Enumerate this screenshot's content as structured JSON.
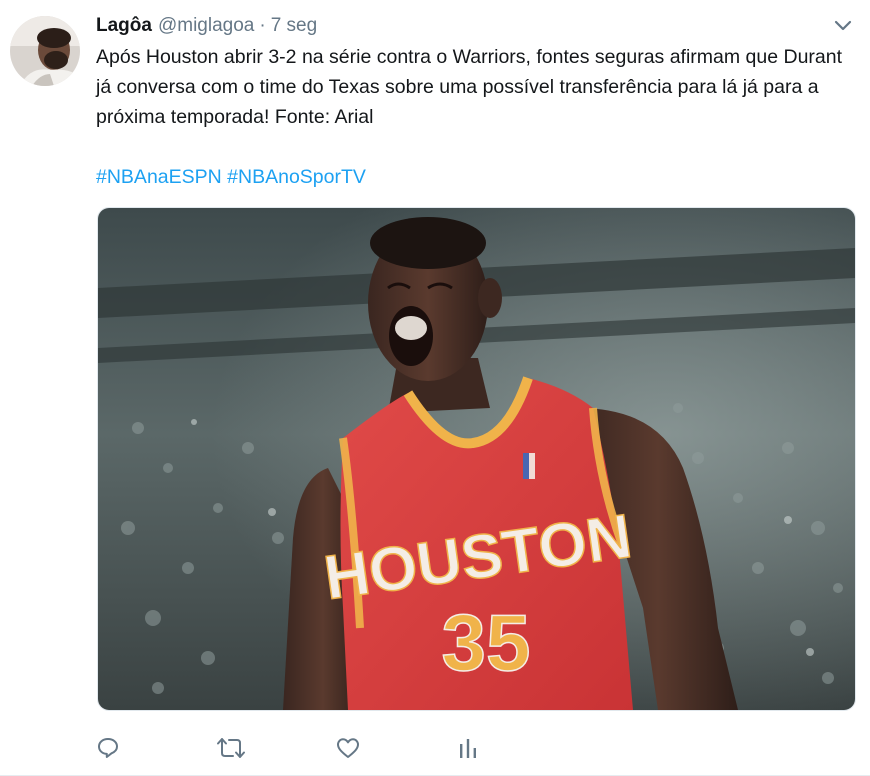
{
  "author": {
    "name": "Lagôa",
    "handle": "@miglagoa",
    "separator": "·",
    "timestamp": "7 seg"
  },
  "tweet": {
    "text": "Após Houston abrir 3-2 na série contra o Warriors, fontes seguras afirmam que Durant já conversa com o time do Texas sobre uma possível transferência para lá já para a próxima temporada! Fonte: Arial",
    "hashtags": [
      "#NBAnaESPN",
      "#NBAnoSporTV"
    ]
  },
  "media": {
    "jersey_text": "HOUSTON",
    "jersey_number": "35"
  },
  "actions": {
    "icons": [
      "reply-icon",
      "retweet-icon",
      "like-icon",
      "analytics-icon"
    ]
  },
  "colors": {
    "link": "#1da1f2",
    "icon": "#657786",
    "jersey_red": "#d93a3c",
    "jersey_gold": "#f0b34a"
  }
}
